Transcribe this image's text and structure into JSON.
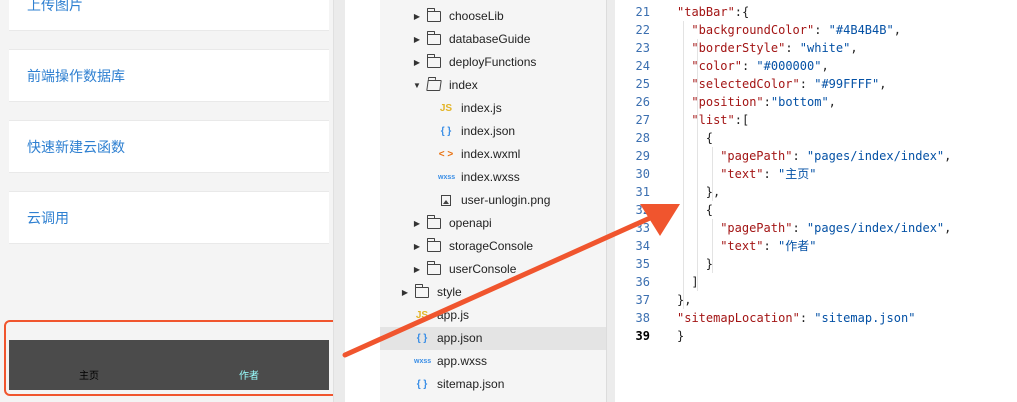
{
  "simulator": {
    "items": [
      {
        "label": "上传图片"
      },
      {
        "label": "前端操作数据库"
      },
      {
        "label": "快速新建云函数"
      },
      {
        "label": "云调用"
      }
    ],
    "tabbar": {
      "background_color": "#4B4B4B",
      "color": "#000000",
      "selected_color": "#99FFFF",
      "tabs": [
        {
          "label": "主页"
        },
        {
          "label": "作者"
        }
      ]
    },
    "highlight_color": "#f0552e"
  },
  "file_tree": {
    "rows": [
      {
        "name": "chooseLib",
        "type": "folder",
        "expanded": false
      },
      {
        "name": "databaseGuide",
        "type": "folder",
        "expanded": false
      },
      {
        "name": "deployFunctions",
        "type": "folder",
        "expanded": false
      },
      {
        "name": "index",
        "type": "folder",
        "expanded": true
      },
      {
        "name": "index.js",
        "type": "js",
        "icon_text": "JS"
      },
      {
        "name": "index.json",
        "type": "json",
        "icon_text": "{ }"
      },
      {
        "name": "index.wxml",
        "type": "wxml",
        "icon_text": "< >"
      },
      {
        "name": "index.wxss",
        "type": "wxss",
        "icon_text": "wxss"
      },
      {
        "name": "user-unlogin.png",
        "type": "png"
      },
      {
        "name": "openapi",
        "type": "folder",
        "expanded": false
      },
      {
        "name": "storageConsole",
        "type": "folder",
        "expanded": false
      },
      {
        "name": "userConsole",
        "type": "folder",
        "expanded": false
      },
      {
        "name": "style",
        "type": "folder",
        "expanded": false
      },
      {
        "name": "app.js",
        "type": "js",
        "icon_text": "JS"
      },
      {
        "name": "app.json",
        "type": "json",
        "icon_text": "{ }",
        "selected": true
      },
      {
        "name": "app.wxss",
        "type": "wxss",
        "icon_text": "wxss"
      },
      {
        "name": "sitemap.json",
        "type": "json",
        "icon_text": "{ }"
      }
    ]
  },
  "editor": {
    "current_line": 39,
    "lines": [
      {
        "n": "21",
        "tokens": [
          [
            "k",
            "\"tabBar\""
          ],
          [
            "p",
            ":{"
          ]
        ]
      },
      {
        "n": "22",
        "tokens": [
          [
            "k",
            "\"backgroundColor\""
          ],
          [
            "p",
            ": "
          ],
          [
            "s",
            "\"#4B4B4B\""
          ],
          [
            "p",
            ","
          ]
        ]
      },
      {
        "n": "23",
        "tokens": [
          [
            "k",
            "\"borderStyle\""
          ],
          [
            "p",
            ": "
          ],
          [
            "s",
            "\"white\""
          ],
          [
            "p",
            ","
          ]
        ]
      },
      {
        "n": "24",
        "tokens": [
          [
            "k",
            "\"color\""
          ],
          [
            "p",
            ": "
          ],
          [
            "s",
            "\"#000000\""
          ],
          [
            "p",
            ","
          ]
        ]
      },
      {
        "n": "25",
        "tokens": [
          [
            "k",
            "\"selectedColor\""
          ],
          [
            "p",
            ": "
          ],
          [
            "s",
            "\"#99FFFF\""
          ],
          [
            "p",
            ","
          ]
        ]
      },
      {
        "n": "26",
        "tokens": [
          [
            "k",
            "\"position\""
          ],
          [
            "p",
            ":"
          ],
          [
            "s",
            "\"bottom\""
          ],
          [
            "p",
            ","
          ]
        ]
      },
      {
        "n": "27",
        "tokens": [
          [
            "k",
            "\"list\""
          ],
          [
            "p",
            ":["
          ]
        ]
      },
      {
        "n": "28",
        "tokens": [
          [
            "p",
            "{"
          ]
        ]
      },
      {
        "n": "29",
        "tokens": [
          [
            "k",
            "\"pagePath\""
          ],
          [
            "p",
            ": "
          ],
          [
            "s",
            "\"pages/index/index\""
          ],
          [
            "p",
            ","
          ]
        ]
      },
      {
        "n": "30",
        "tokens": [
          [
            "k",
            "\"text\""
          ],
          [
            "p",
            ": "
          ],
          [
            "s",
            "\"主页\""
          ]
        ]
      },
      {
        "n": "31",
        "tokens": [
          [
            "p",
            "},"
          ]
        ]
      },
      {
        "n": "32",
        "tokens": [
          [
            "p",
            "{"
          ]
        ]
      },
      {
        "n": "33",
        "tokens": [
          [
            "k",
            "\"pagePath\""
          ],
          [
            "p",
            ": "
          ],
          [
            "s",
            "\"pages/index/index\""
          ],
          [
            "p",
            ","
          ]
        ]
      },
      {
        "n": "34",
        "tokens": [
          [
            "k",
            "\"text\""
          ],
          [
            "p",
            ": "
          ],
          [
            "s",
            "\"作者\""
          ]
        ]
      },
      {
        "n": "35",
        "tokens": [
          [
            "p",
            "}"
          ]
        ]
      },
      {
        "n": "36",
        "tokens": [
          [
            "p",
            "]"
          ]
        ]
      },
      {
        "n": "37",
        "tokens": [
          [
            "p",
            "},"
          ]
        ]
      },
      {
        "n": "38",
        "tokens": [
          [
            "k",
            "\"sitemapLocation\""
          ],
          [
            "p",
            ": "
          ],
          [
            "s",
            "\"sitemap.json\""
          ]
        ]
      },
      {
        "n": "39",
        "tokens": [
          [
            "p",
            "}"
          ]
        ]
      }
    ]
  },
  "annotation": {
    "arrow_color": "#f0552e"
  }
}
